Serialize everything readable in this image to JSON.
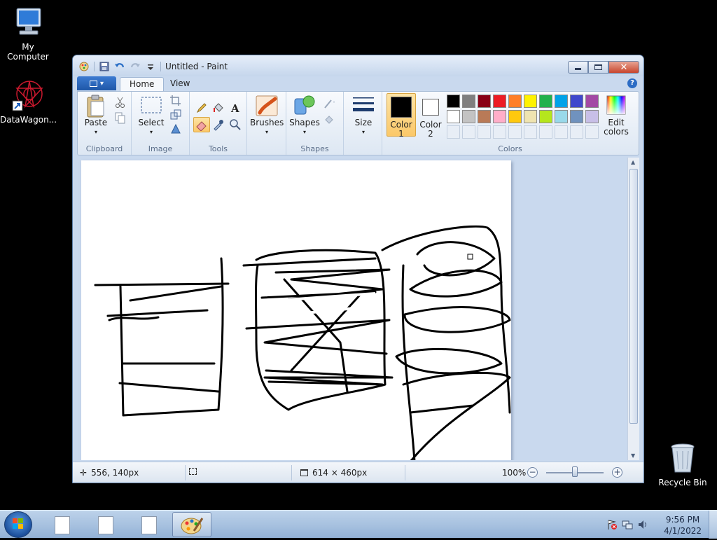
{
  "desktop": {
    "icons": [
      {
        "label": "My Computer"
      },
      {
        "label": "DataWagon..."
      },
      {
        "label": "Recycle Bin"
      }
    ]
  },
  "window": {
    "title": "Untitled - Paint",
    "tabs": {
      "home": "Home",
      "view": "View"
    },
    "help": "?"
  },
  "ribbon": {
    "clipboard": {
      "group": "Clipboard",
      "paste": "Paste"
    },
    "image": {
      "group": "Image",
      "select": "Select"
    },
    "tools": {
      "group": "Tools"
    },
    "brushes": {
      "label": "Brushes"
    },
    "shapes": {
      "group": "Shapes",
      "label": "Shapes"
    },
    "size": {
      "label": "Size"
    },
    "colors": {
      "group": "Colors",
      "color1_line1": "Color",
      "color1_line2": "1",
      "color1_value": "#000000",
      "color2_line1": "Color",
      "color2_line2": "2",
      "color2_value": "#ffffff",
      "edit_line1": "Edit",
      "edit_line2": "colors",
      "palette_row1": [
        "#000000",
        "#7f7f7f",
        "#880015",
        "#ed1c24",
        "#ff7f27",
        "#fff200",
        "#22b14c",
        "#00a2e8",
        "#3f48cc",
        "#a349a4"
      ],
      "palette_row2": [
        "#ffffff",
        "#c3c3c3",
        "#b97a57",
        "#ffaec9",
        "#ffc90e",
        "#efe4b0",
        "#b5e61d",
        "#99d9ea",
        "#7092be",
        "#c8bfe7"
      ]
    }
  },
  "status": {
    "cursor_pos": "556, 140px",
    "canvas_size": "614 × 460px",
    "zoom": "100%",
    "zoom_level": 1.0
  },
  "taskbar": {
    "time": "9:56 PM",
    "date": "4/1/2022"
  },
  "colors": {
    "window_frame": "#c9d9ee",
    "selected_color_highlight": "#fbc869",
    "close_button": "#c8452d"
  }
}
